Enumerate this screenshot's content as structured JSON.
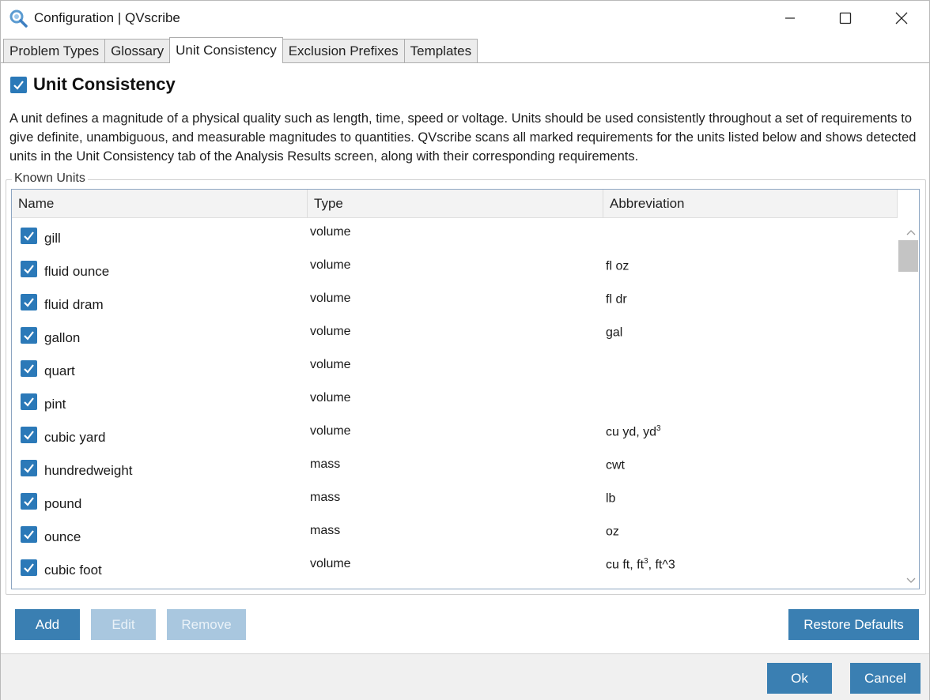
{
  "window": {
    "title": "Configuration | QVscribe"
  },
  "tabs": [
    {
      "label": "Problem Types"
    },
    {
      "label": "Glossary"
    },
    {
      "label": "Unit Consistency"
    },
    {
      "label": "Exclusion Prefixes"
    },
    {
      "label": "Templates"
    }
  ],
  "section": {
    "title": "Unit Consistency",
    "enabled": true,
    "description": "A unit defines a magnitude of a physical quality such as length, time, speed or voltage. Units should be used consistently throughout a set of requirements to give definite, unambiguous, and measurable magnitudes to quantities. QVscribe scans all marked requirements for the units listed below and shows detected units in the Unit Consistency tab of the Analysis Results screen, along with their corresponding requirements."
  },
  "known_units": {
    "label": "Known Units",
    "columns": {
      "name": "Name",
      "type": "Type",
      "abbreviation": "Abbreviation"
    },
    "rows": [
      {
        "name": "gill",
        "type": "volume",
        "abbr_main": "",
        "abbr_sup": "",
        "abbr_tail": "",
        "checked": true
      },
      {
        "name": "fluid ounce",
        "type": "volume",
        "abbr_main": "fl oz",
        "abbr_sup": "",
        "abbr_tail": "",
        "checked": true
      },
      {
        "name": "fluid dram",
        "type": "volume",
        "abbr_main": "fl dr",
        "abbr_sup": "",
        "abbr_tail": "",
        "checked": true
      },
      {
        "name": "gallon",
        "type": "volume",
        "abbr_main": "gal",
        "abbr_sup": "",
        "abbr_tail": "",
        "checked": true
      },
      {
        "name": "quart",
        "type": "volume",
        "abbr_main": "",
        "abbr_sup": "",
        "abbr_tail": "",
        "checked": true
      },
      {
        "name": "pint",
        "type": "volume",
        "abbr_main": "",
        "abbr_sup": "",
        "abbr_tail": "",
        "checked": true
      },
      {
        "name": "cubic yard",
        "type": "volume",
        "abbr_main": "cu yd, yd",
        "abbr_sup": "3",
        "abbr_tail": "",
        "checked": true
      },
      {
        "name": "hundredweight",
        "type": "mass",
        "abbr_main": "cwt",
        "abbr_sup": "",
        "abbr_tail": "",
        "checked": true
      },
      {
        "name": "pound",
        "type": "mass",
        "abbr_main": "lb",
        "abbr_sup": "",
        "abbr_tail": "",
        "checked": true
      },
      {
        "name": "ounce",
        "type": "mass",
        "abbr_main": "oz",
        "abbr_sup": "",
        "abbr_tail": "",
        "checked": true
      },
      {
        "name": "cubic foot",
        "type": "volume",
        "abbr_main": "cu ft, ft",
        "abbr_sup": "3",
        "abbr_tail": ", ft^3",
        "checked": true
      }
    ]
  },
  "buttons": {
    "add": "Add",
    "edit": "Edit",
    "remove": "Remove",
    "restore_defaults": "Restore Defaults",
    "ok": "Ok",
    "cancel": "Cancel"
  },
  "colors": {
    "accent": "#3a7fb2",
    "checkbox": "#2b79b8",
    "disabled_button": "#a9c7df"
  }
}
